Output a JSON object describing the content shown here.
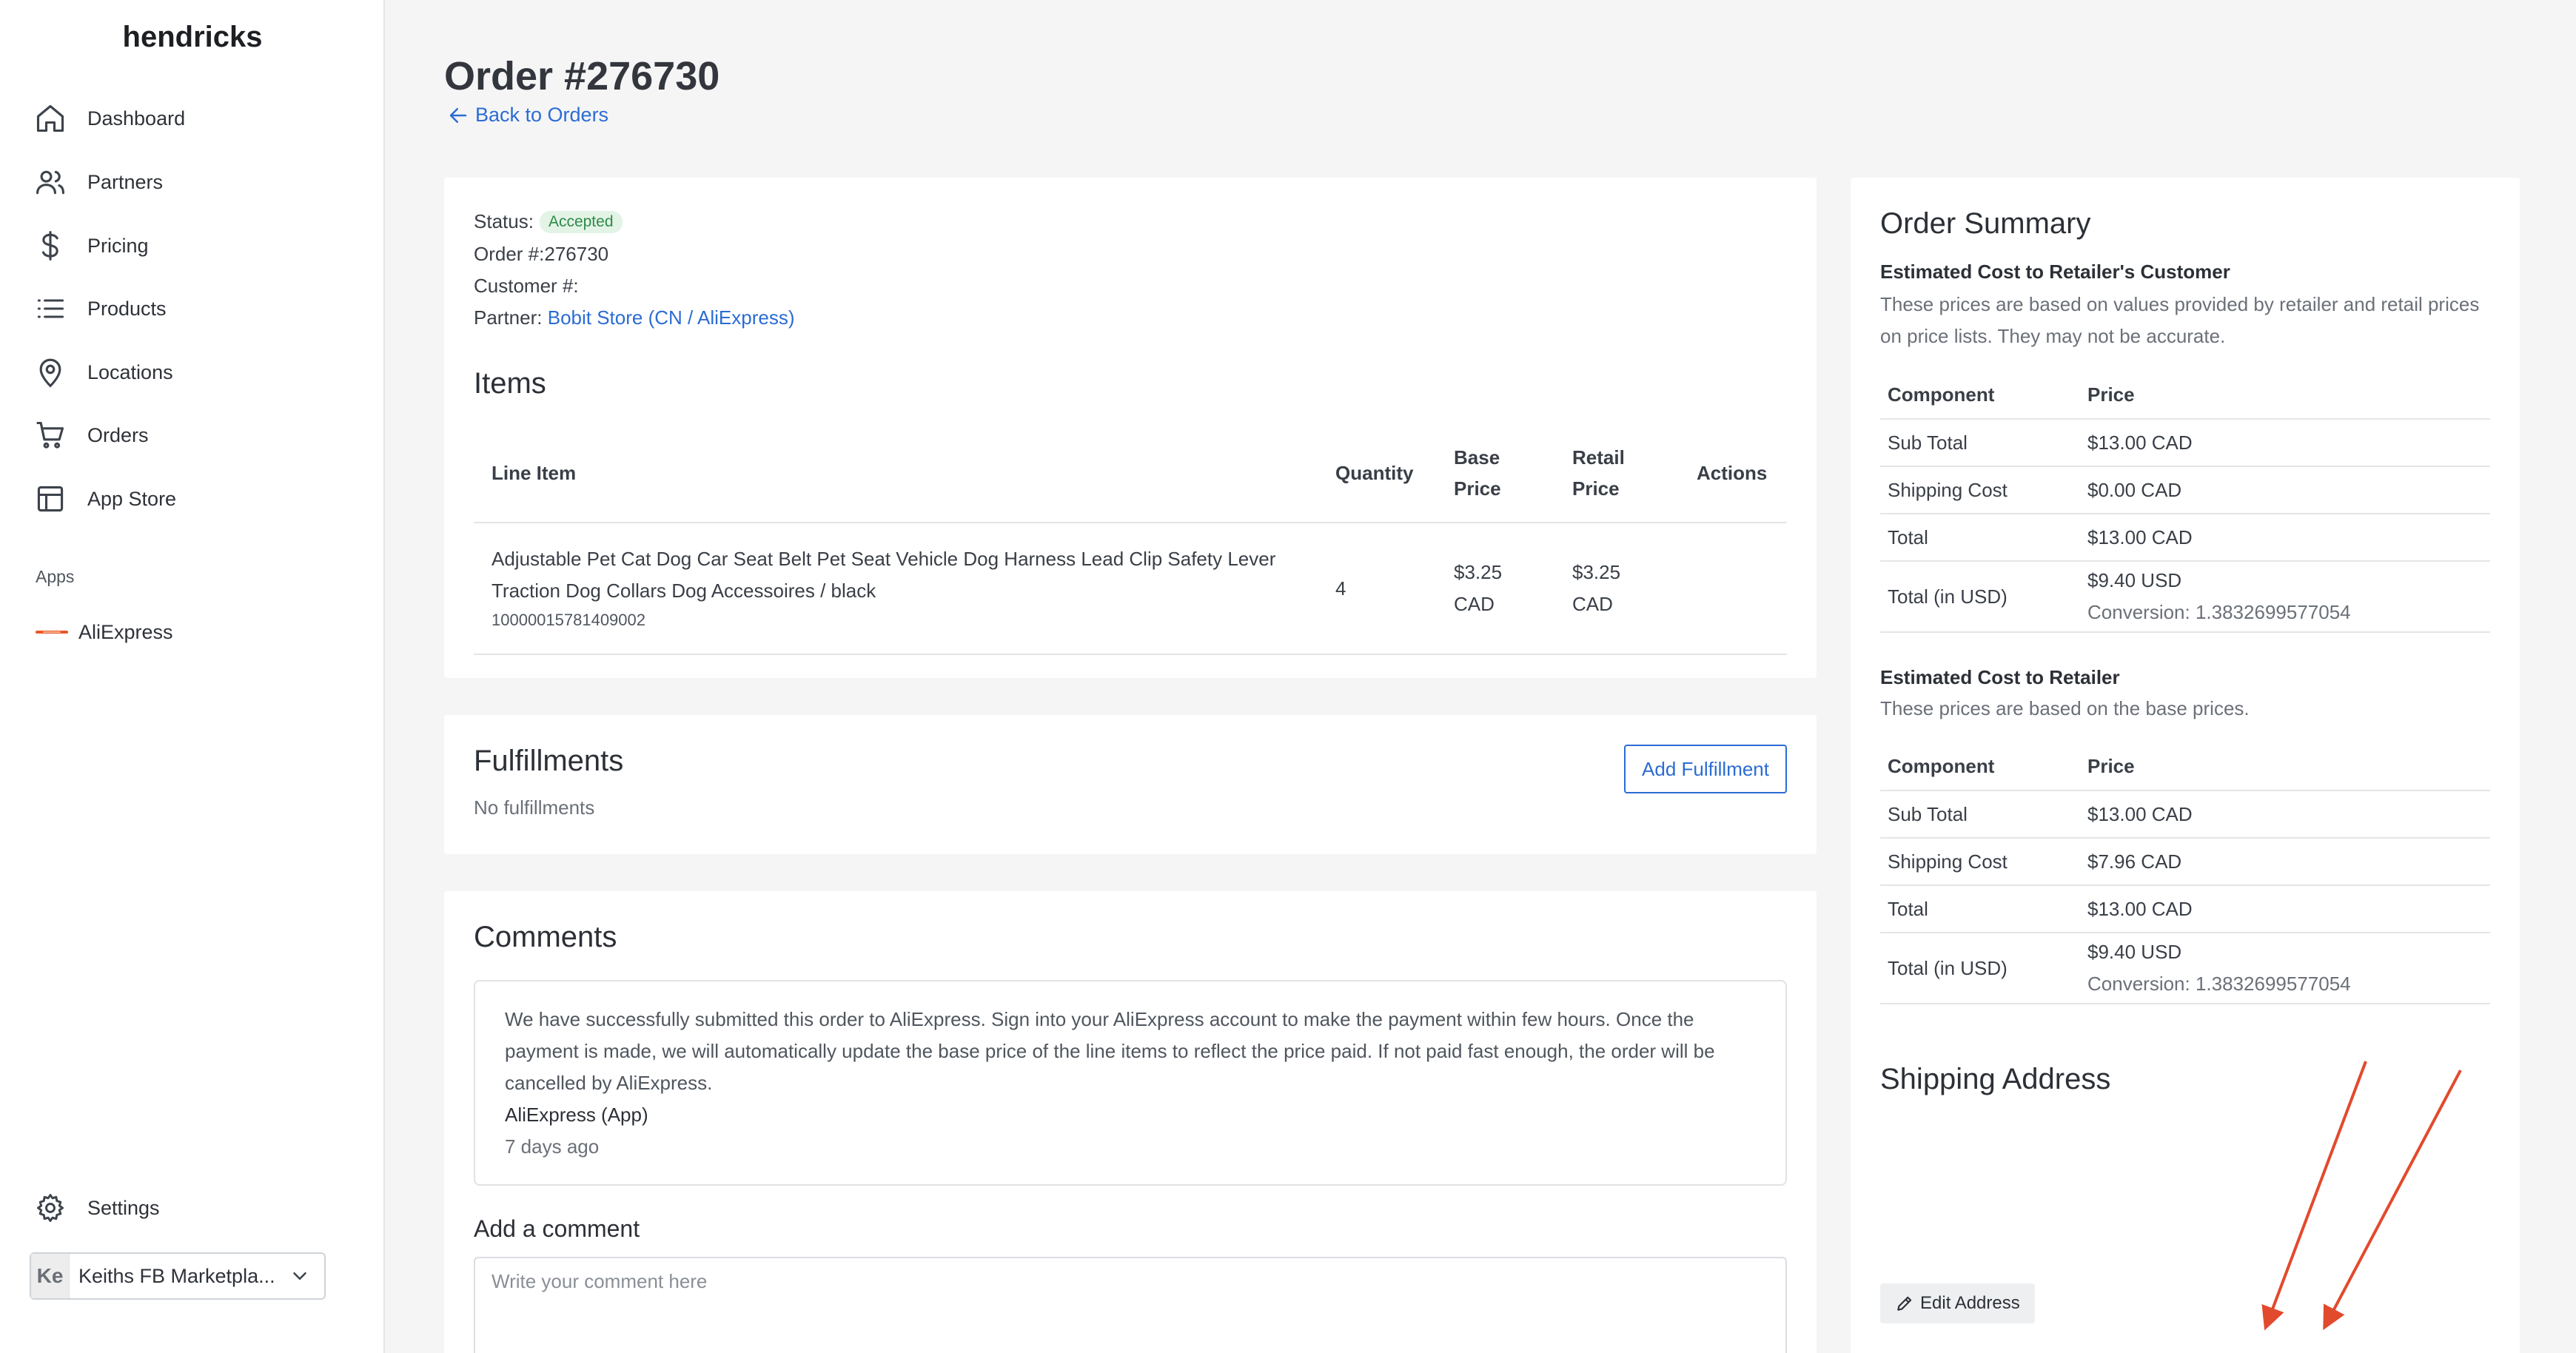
{
  "brand": "hendricks",
  "sidebar": {
    "items": [
      {
        "label": "Dashboard",
        "icon": "home-icon"
      },
      {
        "label": "Partners",
        "icon": "users-icon"
      },
      {
        "label": "Pricing",
        "icon": "dollar-icon"
      },
      {
        "label": "Products",
        "icon": "list-icon"
      },
      {
        "label": "Locations",
        "icon": "map-pin-icon"
      },
      {
        "label": "Orders",
        "icon": "cart-icon"
      },
      {
        "label": "App Store",
        "icon": "layout-icon"
      }
    ],
    "apps_heading": "Apps",
    "apps": [
      {
        "label": "AliExpress",
        "icon": "aliexpress-logo"
      }
    ],
    "settings_label": "Settings",
    "account": {
      "initials": "Ke",
      "name": "Keiths FB Marketpla..."
    }
  },
  "page": {
    "title": "Order #276730",
    "back_label": "Back to Orders"
  },
  "order_info": {
    "status_label": "Status:",
    "status_value": "Accepted",
    "order_number": "Order #:276730",
    "customer_number": "Customer #:",
    "partner_label": "Partner:",
    "partner_value": "Bobit Store (CN / AliExpress)"
  },
  "items": {
    "title": "Items",
    "headers": {
      "line_item": "Line Item",
      "quantity": "Quantity",
      "base_price": "Base Price",
      "retail_price": "Retail Price",
      "actions": "Actions"
    },
    "rows": [
      {
        "name": "Adjustable Pet Cat Dog Car Seat Belt Pet Seat Vehicle Dog Harness Lead Clip Safety Lever Traction Dog Collars Dog Accessoires / black",
        "sku": "10000015781409002",
        "quantity": "4",
        "base_price": "$3.25 CAD",
        "retail_price": "$3.25 CAD"
      }
    ]
  },
  "fulfillments": {
    "title": "Fulfillments",
    "add_label": "Add Fulfillment",
    "empty_text": "No fulfillments"
  },
  "comments": {
    "title": "Comments",
    "entries": [
      {
        "text": "We have successfully submitted this order to AliExpress. Sign into your AliExpress account to make the payment within few hours. Once the payment is made, we will automatically update the base price of the line items to reflect the price paid. If not paid fast enough, the order will be cancelled by AliExpress.",
        "author": "AliExpress (App)",
        "time": "7 days ago"
      }
    ],
    "add_label": "Add a comment",
    "placeholder": "Write your comment here"
  },
  "summary": {
    "title": "Order Summary",
    "customer": {
      "heading": "Estimated Cost to Retailer's Customer",
      "description": "These prices are based on values provided by retailer and retail prices on price lists. They may not be accurate.",
      "col_component": "Component",
      "col_price": "Price",
      "rows": [
        {
          "component": "Sub Total",
          "price": "$13.00 CAD"
        },
        {
          "component": "Shipping Cost",
          "price": "$0.00 CAD"
        },
        {
          "component": "Total",
          "price": "$13.00 CAD"
        }
      ],
      "usd_label": "Total (in USD)",
      "usd_value": "$9.40 USD",
      "conversion": "Conversion: 1.3832699577054"
    },
    "retailer": {
      "heading": "Estimated Cost to Retailer",
      "description": "These prices are based on the base prices.",
      "col_component": "Component",
      "col_price": "Price",
      "rows": [
        {
          "component": "Sub Total",
          "price": "$13.00 CAD"
        },
        {
          "component": "Shipping Cost",
          "price": "$7.96 CAD"
        },
        {
          "component": "Total",
          "price": "$13.00 CAD"
        }
      ],
      "usd_label": "Total (in USD)",
      "usd_value": "$9.40 USD",
      "conversion": "Conversion: 1.3832699577054"
    },
    "shipping_title": "Shipping Address",
    "edit_label": "Edit Address"
  },
  "colors": {
    "accent": "#2b6cd3",
    "status_bg": "#e3f4e7",
    "status_text": "#2f8a48",
    "annotation_arrow": "#e24a2d"
  }
}
